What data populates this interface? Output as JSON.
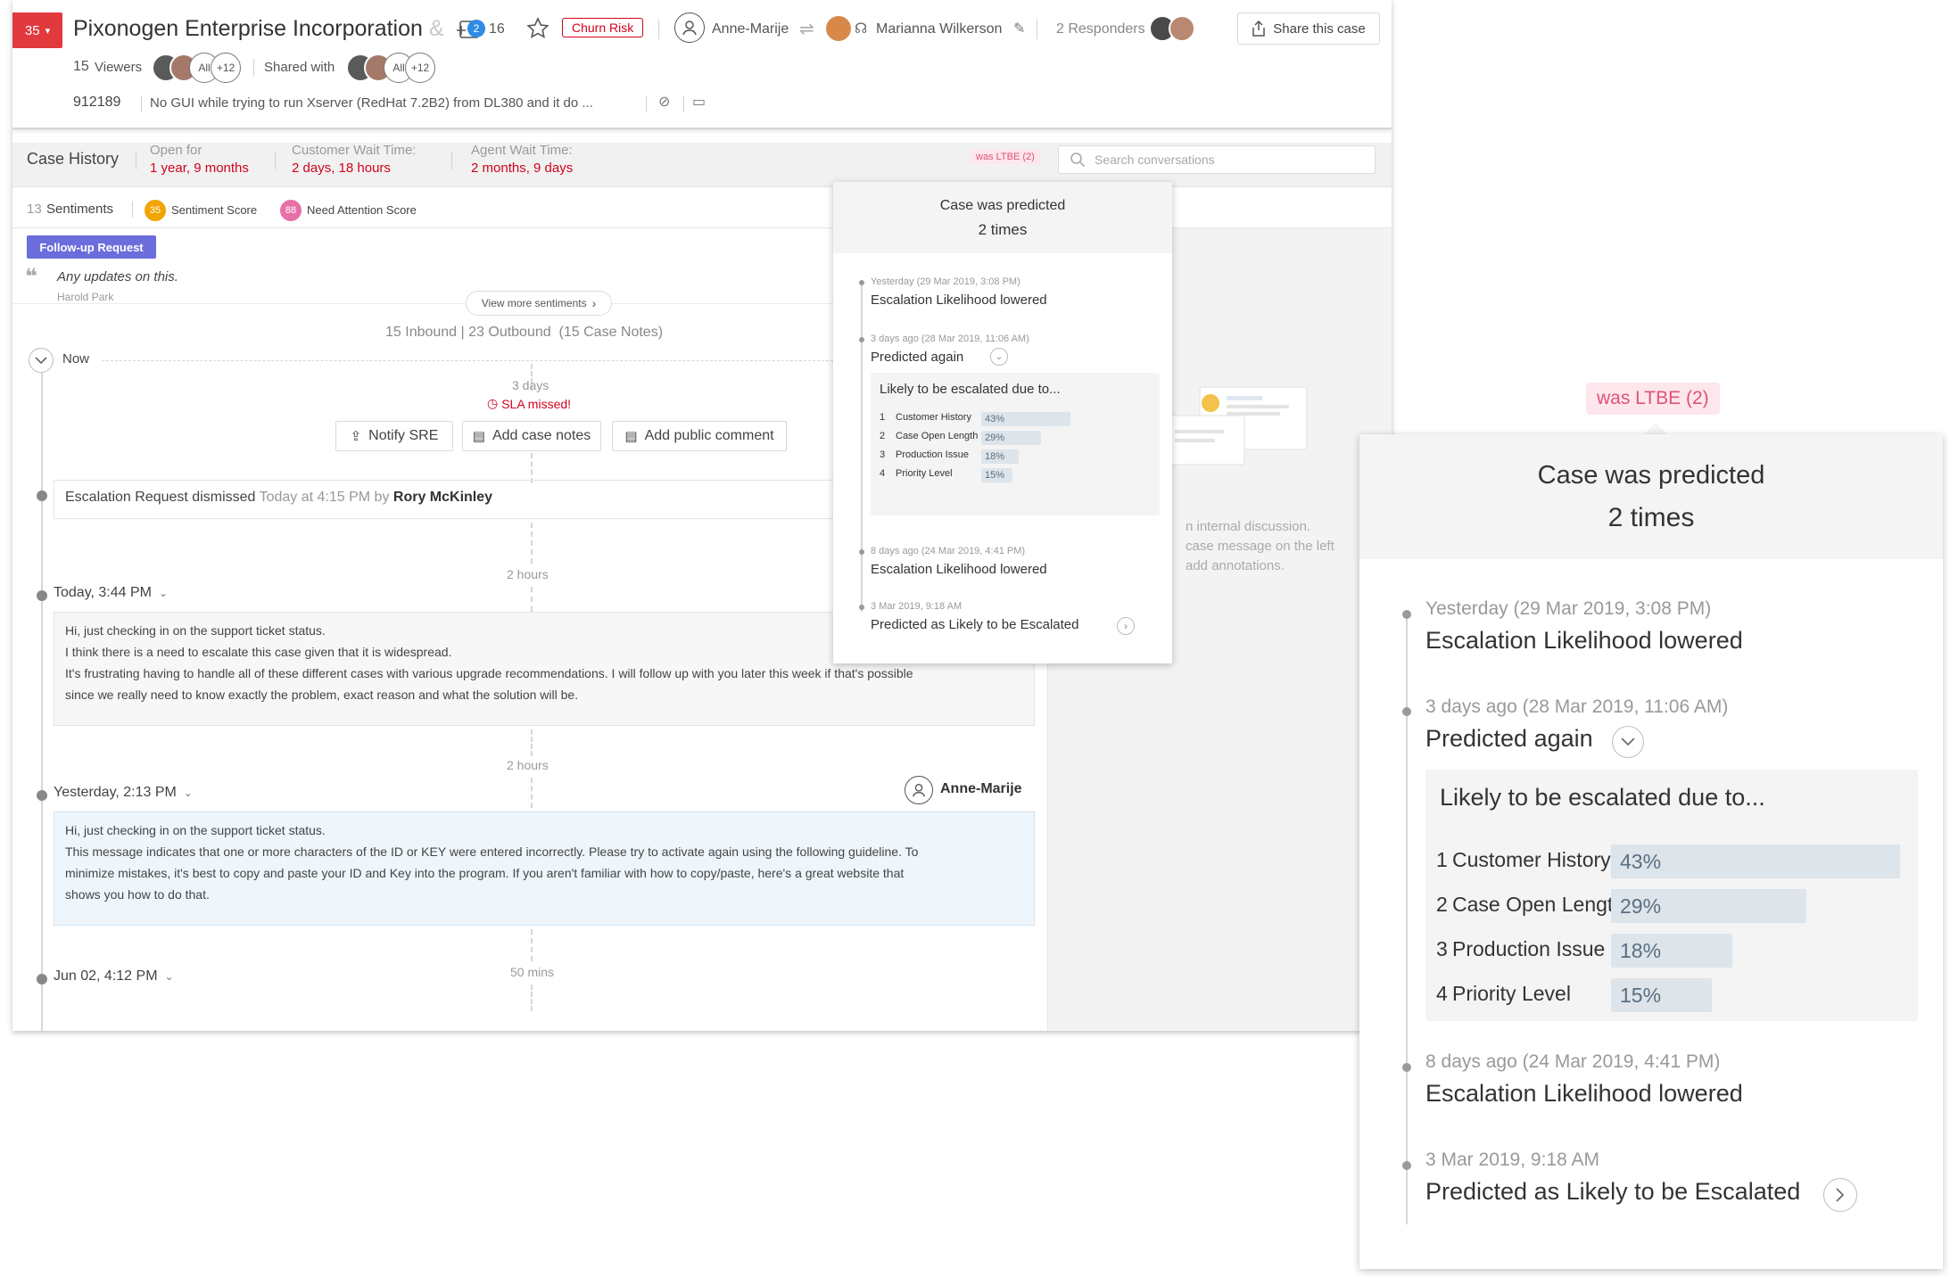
{
  "header": {
    "priority": "35",
    "company": "Pixonogen Enterprise Incorporation",
    "company_fade": "&",
    "add_count": "2",
    "followers": "16",
    "churn_label": "Churn Risk",
    "assignee": "Anne-Marije",
    "owner": "Marianna Wilkerson",
    "responders": "2 Responders",
    "share_label": "Share this case",
    "viewers_count": "15",
    "viewers_label": "Viewers",
    "avatar_all": "All",
    "avatar_more": "+12",
    "shared_with": "Shared with",
    "case_id": "912189",
    "case_subject": "No GUI while trying to run Xserver (RedHat 7.2B2) from DL380 and it do ..."
  },
  "history": {
    "title": "Case History",
    "open_for_label": "Open for",
    "open_for": "1 year, 9 months",
    "cust_wait_label": "Customer Wait Time:",
    "cust_wait": "2 days, 18 hours",
    "agent_wait_label": "Agent Wait Time:",
    "agent_wait": "2 months, 9 days",
    "ltbe_badge": "was LTBE (2)",
    "search_placeholder": "Search conversations"
  },
  "sentiments": {
    "count": "13",
    "label": "Sentiments",
    "score": "35",
    "score_label": "Sentiment Score",
    "attention": "88",
    "attention_label": "Need Attention Score",
    "tag": "Follow-up Request",
    "quote": "Any updates on this.",
    "author": "Harold Park",
    "view_more": "View more sentiments"
  },
  "timeline": {
    "summary": "15 Inbound | 23 Outbound  (15 Case Notes)",
    "now_label": "Now",
    "sla_gap": "3 days",
    "sla_missed": "SLA missed!",
    "notify_sre": "Notify SRE",
    "add_case_notes": "Add case notes",
    "add_public_comment": "Add public comment",
    "dismiss_text": "Escalation Request dismissed",
    "dismiss_when": "Today at 4:15 PM by",
    "dismiss_who": "Rory McKinley",
    "gap1": "2 hours",
    "msg1_time": "Today, 3:44 PM",
    "msg1_lines": [
      "Hi, just checking in on the support ticket status.",
      "I think there is a need to escalate this case given that it is widespread.",
      "It's frustrating having to handle all of these different cases with various upgrade recommendations. I will follow up with you later this week if that's possible",
      "since we really need to know exactly the problem, exact reason and what the solution will be."
    ],
    "gap2": "2 hours",
    "msg2_time": "Yesterday, 2:13 PM",
    "msg2_author": "Anne-Marije",
    "msg2_lines": [
      "Hi, just checking in on the support ticket status.",
      "This message indicates that one or more characters of the ID or KEY were entered incorrectly.  Please try to activate again using the following guideline. To",
      "minimize mistakes, it's best to copy and paste your ID and Key into the program. If you aren't familiar with how to copy/paste, here's a great website that",
      "shows you how to do that."
    ],
    "gap3": "50 mins",
    "msg3_time": "Jun 02, 4:12 PM"
  },
  "right_pane": {
    "hint_lines": [
      "n internal discussion.",
      "case message on the left",
      "add annotations."
    ]
  },
  "prediction": {
    "badge": "was LTBE (2)",
    "heading": "Case was predicted",
    "times": "2 times",
    "events": [
      {
        "when": "Yesterday (29 Mar 2019, 3:08 PM)",
        "what": "Escalation Likelihood lowered"
      },
      {
        "when": "3 days ago (28 Mar 2019, 11:06 AM)",
        "what": "Predicted again"
      },
      {
        "when": "8 days ago (24 Mar 2019, 4:41 PM)",
        "what": "Escalation Likelihood lowered"
      },
      {
        "when": "3 Mar 2019, 9:18 AM",
        "what": "Predicted as Likely to be Escalated"
      }
    ],
    "reasons_title": "Likely to be escalated due to...",
    "reasons": [
      {
        "rank": "1",
        "name": "Customer History",
        "pct_label": "43%",
        "pct": 43
      },
      {
        "rank": "2",
        "name": "Case Open Length",
        "pct_label": "29%",
        "pct": 29
      },
      {
        "rank": "3",
        "name": "Production Issue",
        "pct_label": "18%",
        "pct": 18
      },
      {
        "rank": "4",
        "name": "Priority Level",
        "pct_label": "15%",
        "pct": 15
      }
    ]
  },
  "colors": {
    "accent_red": "#d0021b",
    "priority_bg": "#e0393e",
    "followup": "#6a6ddb",
    "sentiment_score": "#f0a500",
    "attention_score": "#e870a8",
    "ltbe_bg": "#fde6ec",
    "ltbe_text": "#e0527a"
  }
}
